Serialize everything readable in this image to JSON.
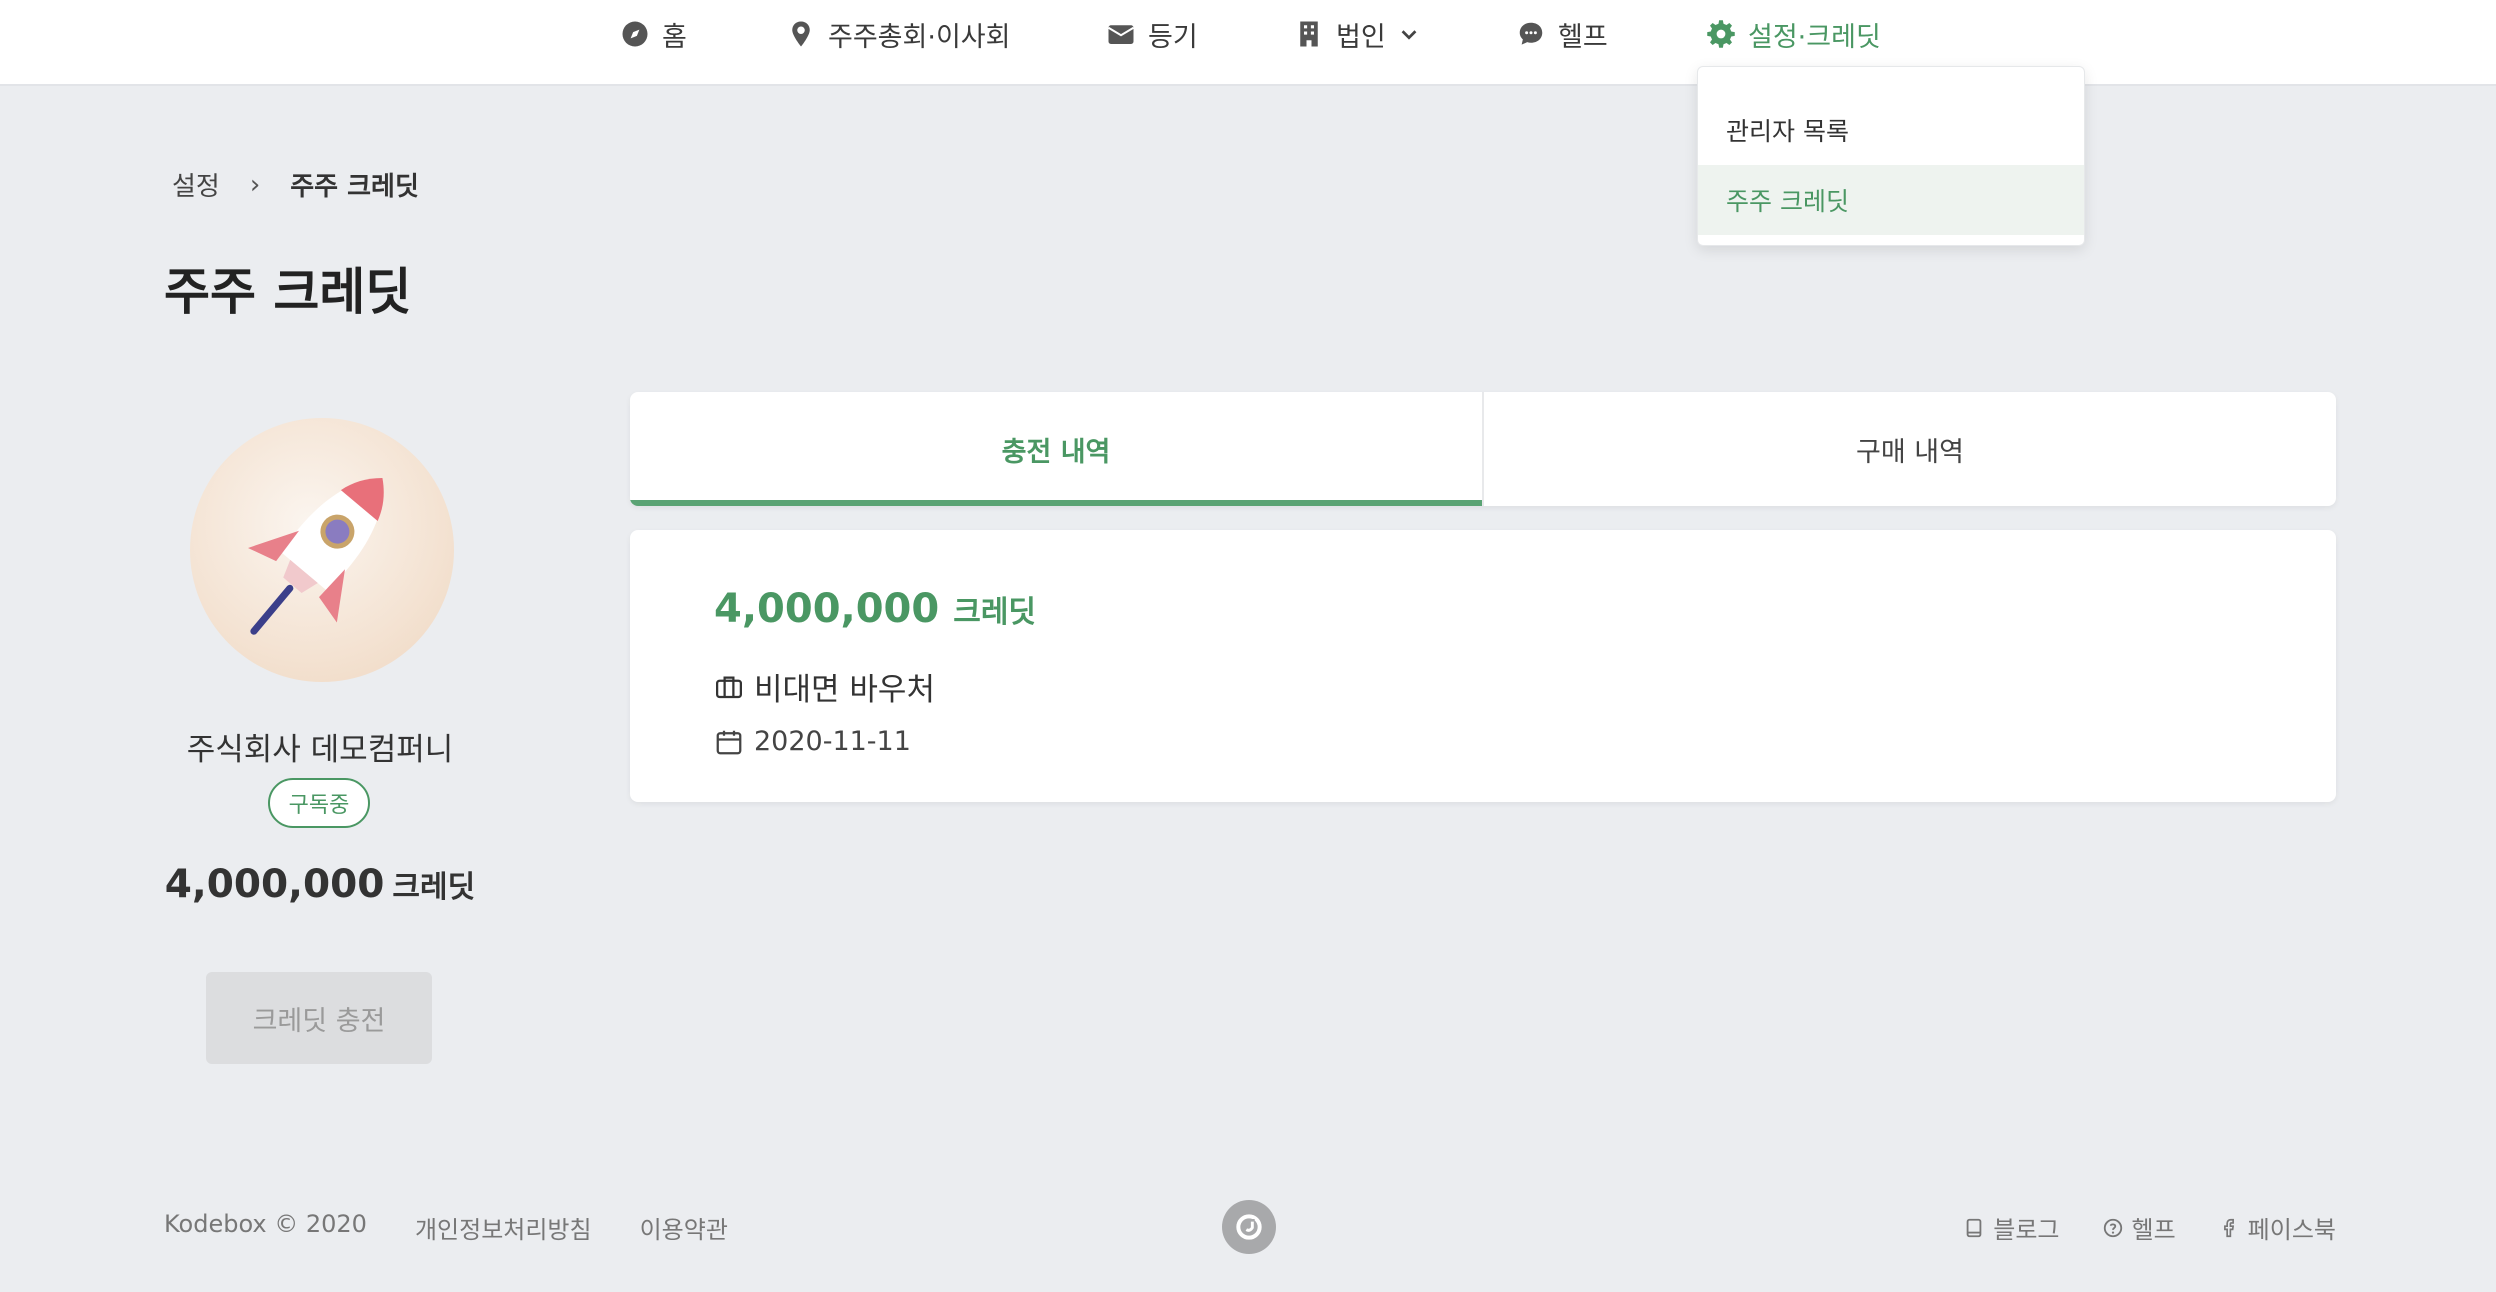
{
  "nav": {
    "items": [
      {
        "label": "홈",
        "icon": "compass-icon"
      },
      {
        "label": "주주총회·이사회",
        "icon": "location-pin-icon"
      },
      {
        "label": "등기",
        "icon": "mail-icon"
      },
      {
        "label": "법인",
        "icon": "building-icon"
      },
      {
        "label": "헬프",
        "icon": "chat-icon"
      },
      {
        "label": "설정·크레딧",
        "icon": "gear-icon"
      }
    ],
    "active_color": "#4a9763"
  },
  "dropdown": {
    "items": [
      {
        "label": "관리자 목록"
      },
      {
        "label": "주주 크레딧"
      }
    ]
  },
  "breadcrumb": {
    "parent": "설정",
    "separator": "›",
    "current": "주주 크레딧"
  },
  "page": {
    "title": "주주 크레딧"
  },
  "profile": {
    "company_name": "주식회사 데모컴퍼니",
    "badge": "구독중",
    "credit_amount": "4,000,000",
    "credit_unit": "크레딧",
    "charge_button": "크레딧 충전"
  },
  "tabs": [
    {
      "label": "충전 내역",
      "active": true
    },
    {
      "label": "구매 내역",
      "active": false
    }
  ],
  "history": [
    {
      "amount": "4,000,000",
      "unit": "크레딧",
      "source": "비대면 바우처",
      "date": "2020-11-11"
    }
  ],
  "footer": {
    "copyright": "Kodebox © 2020",
    "privacy": "개인정보처리방침",
    "terms": "이용약관",
    "links": [
      {
        "label": "블로그",
        "icon": "book-icon"
      },
      {
        "label": "헬프",
        "icon": "question-icon"
      },
      {
        "label": "페이스북",
        "icon": "facebook-icon"
      }
    ]
  },
  "colors": {
    "accent": "#4a9763",
    "background": "#ebedf0"
  }
}
